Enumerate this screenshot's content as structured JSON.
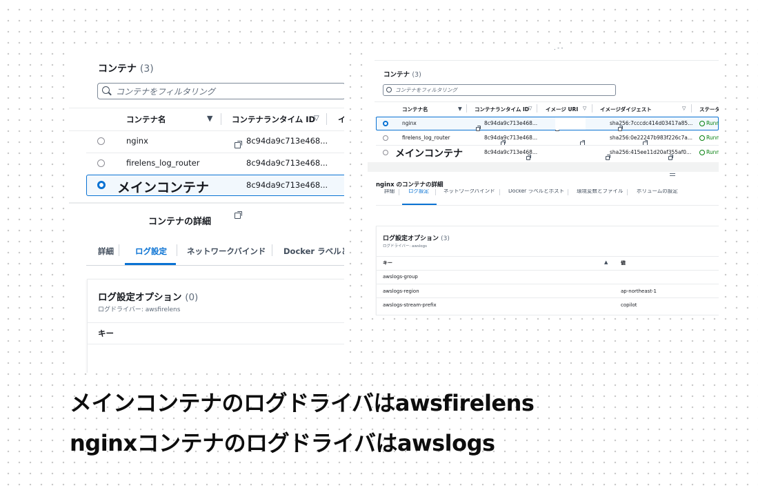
{
  "left": {
    "header_title": "コンテナ",
    "header_count": "(3)",
    "filter_placeholder": "コンテナをフィルタリング",
    "columns": [
      "コンテナ名",
      "コンテナランタイム ID",
      "イ"
    ],
    "rows": [
      {
        "name": "nginx",
        "runtime_id": "8c94da9c713e468...",
        "selected": false
      },
      {
        "name": "firelens_log_router",
        "runtime_id": "8c94da9c713e468...",
        "selected": false
      },
      {
        "name": "メインコンテナ",
        "runtime_id": "8c94da9c713e468...",
        "selected": true
      }
    ],
    "detail_title": "コンテナの詳細",
    "tabs": [
      "詳細",
      "ログ設定",
      "ネットワークバインド",
      "Docker ラベルとホ"
    ],
    "log_title": "ログ設定オプション",
    "log_count": "(0)",
    "log_driver": "ログドライバー: awsfirelens",
    "key_header": "キー"
  },
  "right": {
    "header_title": "コンテナ",
    "header_count": "(3)",
    "filter_placeholder": "コンテナをフィルタリング",
    "columns": [
      "コンテナ名",
      "コンテナランタイム ID",
      "イメージ URI",
      "イメージダイジェスト",
      "ステータ"
    ],
    "rows": [
      {
        "name": "nginx",
        "runtime_id": "8c94da9c713e468...",
        "digest": "sha256:7cccdc414d03417a85...",
        "status": "Runni",
        "selected": true
      },
      {
        "name": "firelens_log_router",
        "runtime_id": "8c94da9c713e468...",
        "digest": "sha256:0e22247b983f226c7a...",
        "status": "Runni",
        "selected": false
      },
      {
        "name": "メインコンテナ",
        "runtime_id": "8c94da9c713e468...",
        "digest": "sha256:415ee11d20af355af0...",
        "status": "Runni",
        "selected": false
      }
    ],
    "detail_title": "nginx のコンテナの詳細",
    "tabs": [
      "詳細",
      "ログ設定",
      "ネットワークバインド",
      "Docker ラベルとホスト",
      "環境変数とファイル",
      "ボリュームの設定"
    ],
    "log_title": "ログ設定オプション",
    "log_count": "(3)",
    "log_driver": "ログドライバー: awslogs",
    "key_header": "キー",
    "value_header": "値",
    "log_rows": [
      {
        "key": "awslogs-group",
        "value": ""
      },
      {
        "key": "awslogs-region",
        "value": "ap-northeast-1"
      },
      {
        "key": "awslogs-stream-prefix",
        "value": "copilot"
      }
    ]
  },
  "captions": [
    "メインコンテナのログドライバはawsfirelens",
    "nginxコンテナのログドライバはawslogs"
  ]
}
